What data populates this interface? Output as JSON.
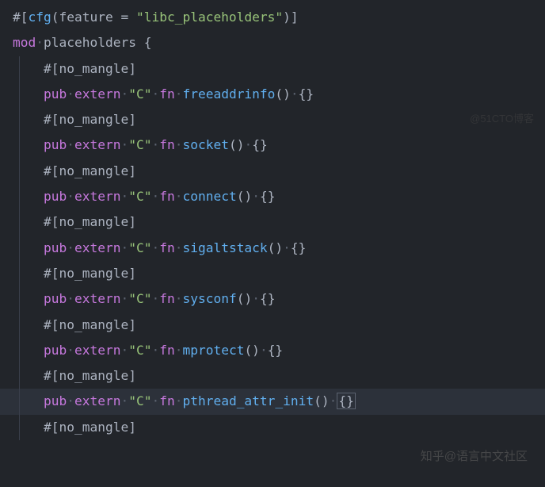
{
  "code": {
    "line1": {
      "hash": "#",
      "br1": "[",
      "cfg": "cfg",
      "paren1": "(",
      "feature": "feature",
      "sp1": " ",
      "eq": "=",
      "sp2": " ",
      "str": "\"libc_placeholders\"",
      "paren2": ")",
      "br2": "]"
    },
    "line2": {
      "mod": "mod",
      "dot": "·",
      "name": "placeholders",
      "sp": " ",
      "brace": "{"
    },
    "attr_line": {
      "hash": "#",
      "br1": "[",
      "name": "no_mangle",
      "br2": "]"
    },
    "fn_sig": {
      "pub": "pub",
      "extern": "extern",
      "c": "\"C\"",
      "fn": "fn",
      "parens": "()",
      "braces": "{}"
    },
    "functions": [
      "freeaddrinfo",
      "socket",
      "connect",
      "sigaltstack",
      "sysconf",
      "mprotect",
      "pthread_attr_init"
    ]
  },
  "watermark": "知乎@语言中文社区",
  "watermark2": "@51CTO博客"
}
